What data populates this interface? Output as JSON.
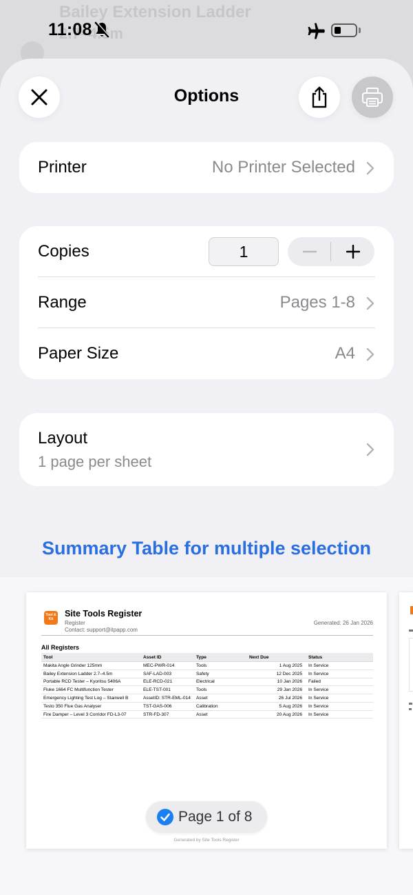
{
  "background_app": {
    "title": "Bailey Extension Ladder",
    "subtitle": "2.7–4.5m"
  },
  "status_bar": {
    "time": "11:08",
    "battery_percent": 30
  },
  "header": {
    "title": "Options"
  },
  "printer": {
    "label": "Printer",
    "value": "No Printer Selected"
  },
  "copies": {
    "label": "Copies",
    "value": "1"
  },
  "range": {
    "label": "Range",
    "value": "Pages 1-8"
  },
  "paper_size": {
    "label": "Paper Size",
    "value": "A4"
  },
  "layout": {
    "label": "Layout",
    "value": "1 page per sheet"
  },
  "summary_title": "Summary Table for multiple selection",
  "preview": {
    "logo_text": "Tool & Kit",
    "doc_title": "Site Tools Register",
    "doc_subtitle": "Register",
    "contact": "Contact: support@itpapp.com",
    "generated": "Generated: 26 Jan 2026",
    "section_title": "All Registers",
    "columns": [
      "Tool",
      "Asset ID",
      "Type",
      "Next Due",
      "Status"
    ],
    "rows": [
      [
        "Makita Angle Grinder 125mm",
        "MEC-PWR-014",
        "Tools",
        "1 Aug 2025",
        "In Service"
      ],
      [
        "Bailey Extension Ladder 2.7–4.5m",
        "SAF-LAD-003",
        "Safety",
        "12 Dec 2025",
        "In Service"
      ],
      [
        "Portable RCD Tester – Kyoritsu 5406A",
        "ELE-RCD-021",
        "Electrical",
        "10 Jan 2026",
        "Failed"
      ],
      [
        "Fluke 1664 FC Multifunction Tester",
        "ELE-TST-001",
        "Tools",
        "29 Jan 2026",
        "In Service"
      ],
      [
        "Emergency Lighting Test Log – Stairwell B",
        "AssetID: STR-EML-014",
        "Asset",
        "26 Jul 2026",
        "In Service"
      ],
      [
        "Testo 350 Flue Gas Analyser",
        "TST-GAS-006",
        "Calibration",
        "5 Aug 2026",
        "In Service"
      ],
      [
        "Fire Damper – Level 3 Corridor FD-L3-07",
        "STR-FD-307",
        "Asset",
        "20 Aug 2026",
        "In Service"
      ]
    ],
    "footer": "Generated by Site Tools Register",
    "page_indicator": "Page 1 of 8"
  },
  "colors": {
    "accent_blue": "#2b6ee0",
    "check_blue": "#1a7ff0",
    "logo_orange": "#f07a1a"
  },
  "icons": [
    "bell-slash-icon",
    "airplane-icon",
    "battery-icon",
    "close-icon",
    "share-icon",
    "printer-icon",
    "chevron-right-icon",
    "minus-icon",
    "plus-icon",
    "checkmark-icon"
  ]
}
